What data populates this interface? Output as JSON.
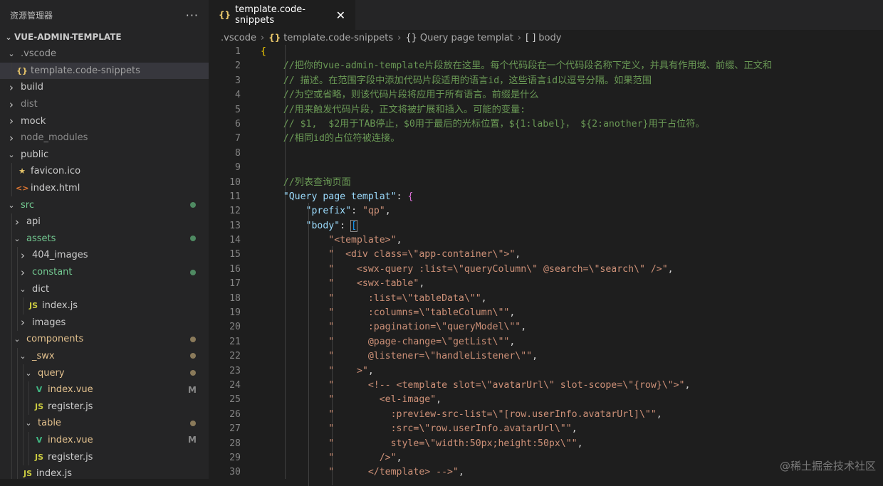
{
  "explorer": {
    "title": "资源管理器",
    "more_label": "···",
    "root": "VUE-ADMIN-TEMPLATE",
    "items": [
      {
        "label": ".vscode",
        "type": "folder",
        "open": true,
        "level": 0,
        "color": "#a0a0a0"
      },
      {
        "label": "template.code-snippets",
        "type": "file",
        "icon": "{}",
        "icon_color": "#e8c66a",
        "level": 1,
        "selected": true,
        "color": "#a0a0a0"
      },
      {
        "label": "build",
        "type": "folder",
        "open": false,
        "level": 0,
        "color": "#cccccc"
      },
      {
        "label": "dist",
        "type": "folder",
        "open": false,
        "level": 0,
        "color": "#8c8c8c"
      },
      {
        "label": "mock",
        "type": "folder",
        "open": false,
        "level": 0,
        "color": "#cccccc"
      },
      {
        "label": "node_modules",
        "type": "folder",
        "open": false,
        "level": 0,
        "color": "#8c8c8c"
      },
      {
        "label": "public",
        "type": "folder",
        "open": true,
        "level": 0,
        "color": "#cccccc"
      },
      {
        "label": "favicon.ico",
        "type": "file",
        "icon": "★",
        "icon_color": "#e8c66a",
        "level": 1,
        "color": "#cccccc"
      },
      {
        "label": "index.html",
        "type": "file",
        "icon": "<>",
        "icon_color": "#e37933",
        "level": 1,
        "color": "#cccccc"
      },
      {
        "label": "src",
        "type": "folder",
        "open": true,
        "level": 0,
        "color": "#73c991",
        "dot": "#4f8a62"
      },
      {
        "label": "api",
        "type": "folder",
        "open": false,
        "level": 1,
        "color": "#cccccc"
      },
      {
        "label": "assets",
        "type": "folder",
        "open": true,
        "level": 1,
        "color": "#73c991",
        "dot": "#4f8a62"
      },
      {
        "label": "404_images",
        "type": "folder",
        "open": false,
        "level": 2,
        "color": "#cccccc"
      },
      {
        "label": "constant",
        "type": "folder",
        "open": false,
        "level": 2,
        "color": "#73c991",
        "dot": "#4f8a62"
      },
      {
        "label": "dict",
        "type": "folder",
        "open": true,
        "level": 2,
        "color": "#cccccc"
      },
      {
        "label": "index.js",
        "type": "file",
        "icon": "JS",
        "icon_color": "#cbcb41",
        "level": 3,
        "color": "#cccccc"
      },
      {
        "label": "images",
        "type": "folder",
        "open": false,
        "level": 2,
        "color": "#cccccc"
      },
      {
        "label": "components",
        "type": "folder",
        "open": true,
        "level": 1,
        "color": "#e2c08d",
        "dot": "#8a7a5a"
      },
      {
        "label": "_swx",
        "type": "folder",
        "open": true,
        "level": 2,
        "color": "#e2c08d",
        "dot": "#8a7a5a"
      },
      {
        "label": "query",
        "type": "folder",
        "open": true,
        "level": 3,
        "color": "#e2c08d",
        "dot": "#8a7a5a"
      },
      {
        "label": "index.vue",
        "type": "file",
        "icon": "V",
        "icon_color": "#41b883",
        "level": 4,
        "color": "#e2c08d",
        "badge": "M"
      },
      {
        "label": "register.js",
        "type": "file",
        "icon": "JS",
        "icon_color": "#cbcb41",
        "level": 4,
        "color": "#cccccc"
      },
      {
        "label": "table",
        "type": "folder",
        "open": true,
        "level": 3,
        "color": "#e2c08d",
        "dot": "#8a7a5a"
      },
      {
        "label": "index.vue",
        "type": "file",
        "icon": "V",
        "icon_color": "#41b883",
        "level": 4,
        "color": "#e2c08d",
        "badge": "M"
      },
      {
        "label": "register.js",
        "type": "file",
        "icon": "JS",
        "icon_color": "#cbcb41",
        "level": 4,
        "color": "#cccccc"
      },
      {
        "label": "index.js",
        "type": "file",
        "icon": "JS",
        "icon_color": "#cbcb41",
        "level": 2,
        "color": "#cccccc"
      }
    ]
  },
  "tab": {
    "icon": "{}",
    "label": "template.code-snippets",
    "close_label": "✕"
  },
  "breadcrumb": {
    "items": [
      {
        "label": ".vscode",
        "icon": ""
      },
      {
        "label": "template.code-snippets",
        "icon": "{}"
      },
      {
        "label": "Query page templat",
        "icon": "{}"
      },
      {
        "label": "body",
        "icon": "[ ]"
      }
    ],
    "separator": "›"
  },
  "code": {
    "lines": [
      [
        [
          "{",
          "br1"
        ]
      ],
      [
        [
          "    //把你的vue-admin-template片段放在这里。每个代码段在一个代码段名称下定义，并具有作用域、前缀、正文和",
          "cmt"
        ]
      ],
      [
        [
          "    // 描述。在范围字段中添加代码片段适用的语言id，这些语言id以逗号分隔。如果范围",
          "cmt"
        ]
      ],
      [
        [
          "    //为空或省略，则该代码片段将应用于所有语言。前缀是什么",
          "cmt"
        ]
      ],
      [
        [
          "    //用来触发代码片段，正文将被扩展和插入。可能的变量:",
          "cmt"
        ]
      ],
      [
        [
          "    // $1,  $2用于TAB停止，$0用于最后的光标位置，${1:label}， ${2:another}用于占位符。",
          "cmt"
        ]
      ],
      [
        [
          "    //相同id的占位符被连接。",
          "cmt"
        ]
      ],
      [
        [
          "",
          "plain"
        ]
      ],
      [
        [
          "",
          "plain"
        ]
      ],
      [
        [
          "    //列表查询页面",
          "cmt"
        ]
      ],
      [
        [
          "    ",
          "plain"
        ],
        [
          "\"Query page templat\"",
          "key"
        ],
        [
          ": ",
          "plain"
        ],
        [
          "{",
          "br2"
        ]
      ],
      [
        [
          "        ",
          "plain"
        ],
        [
          "\"prefix\"",
          "key"
        ],
        [
          ": ",
          "plain"
        ],
        [
          "\"qp\"",
          "str"
        ],
        [
          ",",
          "plain"
        ]
      ],
      [
        [
          "        ",
          "plain"
        ],
        [
          "\"body\"",
          "key"
        ],
        [
          ": ",
          "plain"
        ],
        [
          "[",
          "br3box"
        ]
      ],
      [
        [
          "            ",
          "plain"
        ],
        [
          "\"<template>\"",
          "str"
        ],
        [
          ",",
          "plain"
        ]
      ],
      [
        [
          "            ",
          "plain"
        ],
        [
          "\"  <div class=\\\"app-container\\\">\"",
          "str"
        ],
        [
          ",",
          "plain"
        ]
      ],
      [
        [
          "            ",
          "plain"
        ],
        [
          "\"    <swx-query :list=\\\"queryColumn\\\" @search=\\\"search\\\" />\"",
          "str"
        ],
        [
          ",",
          "plain"
        ]
      ],
      [
        [
          "            ",
          "plain"
        ],
        [
          "\"    <swx-table\"",
          "str"
        ],
        [
          ",",
          "plain"
        ]
      ],
      [
        [
          "            ",
          "plain"
        ],
        [
          "\"      :list=\\\"tableData\\\"\"",
          "str"
        ],
        [
          ",",
          "plain"
        ]
      ],
      [
        [
          "            ",
          "plain"
        ],
        [
          "\"      :columns=\\\"tableColumn\\\"\"",
          "str"
        ],
        [
          ",",
          "plain"
        ]
      ],
      [
        [
          "            ",
          "plain"
        ],
        [
          "\"      :pagination=\\\"queryModel\\\"\"",
          "str"
        ],
        [
          ",",
          "plain"
        ]
      ],
      [
        [
          "            ",
          "plain"
        ],
        [
          "\"      @page-change=\\\"getList\\\"\"",
          "str"
        ],
        [
          ",",
          "plain"
        ]
      ],
      [
        [
          "            ",
          "plain"
        ],
        [
          "\"      @listener=\\\"handleListener\\\"\"",
          "str"
        ],
        [
          ",",
          "plain"
        ]
      ],
      [
        [
          "            ",
          "plain"
        ],
        [
          "\"    >\"",
          "str"
        ],
        [
          ",",
          "plain"
        ]
      ],
      [
        [
          "            ",
          "plain"
        ],
        [
          "\"      <!-- <template slot=\\\"avatarUrl\\\" slot-scope=\\\"{row}\\\">\"",
          "str"
        ],
        [
          ",",
          "plain"
        ]
      ],
      [
        [
          "            ",
          "plain"
        ],
        [
          "\"        <el-image\"",
          "str"
        ],
        [
          ",",
          "plain"
        ]
      ],
      [
        [
          "            ",
          "plain"
        ],
        [
          "\"          :preview-src-list=\\\"[row.userInfo.avatarUrl]\\\"\"",
          "str"
        ],
        [
          ",",
          "plain"
        ]
      ],
      [
        [
          "            ",
          "plain"
        ],
        [
          "\"          :src=\\\"row.userInfo.avatarUrl\\\"\"",
          "str"
        ],
        [
          ",",
          "plain"
        ]
      ],
      [
        [
          "            ",
          "plain"
        ],
        [
          "\"          style=\\\"width:50px;height:50px\\\"\"",
          "str"
        ],
        [
          ",",
          "plain"
        ]
      ],
      [
        [
          "            ",
          "plain"
        ],
        [
          "\"        />\"",
          "str"
        ],
        [
          ",",
          "plain"
        ]
      ],
      [
        [
          "            ",
          "plain"
        ],
        [
          "\"      </template> -->\"",
          "str"
        ],
        [
          ",",
          "plain"
        ]
      ]
    ]
  },
  "watermark": "@稀土掘金技术社区"
}
